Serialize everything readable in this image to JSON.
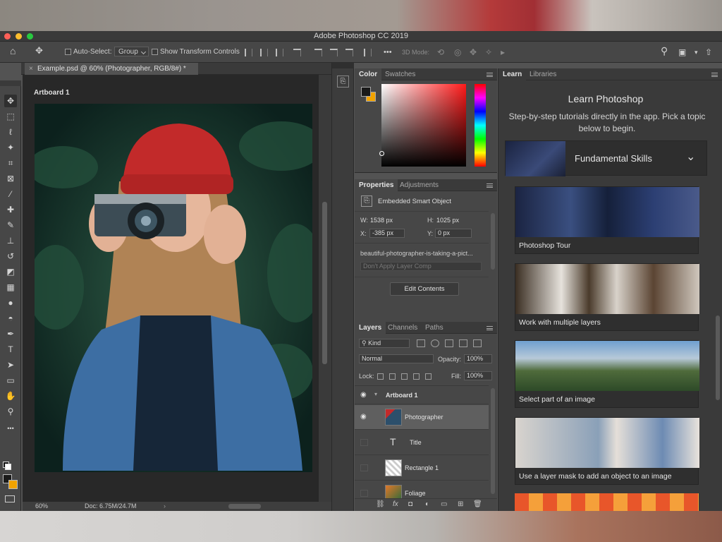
{
  "window": {
    "title": "Adobe Photoshop CC 2019"
  },
  "options_bar": {
    "auto_select_label": "Auto-Select:",
    "auto_select_value": "Group",
    "show_transform_label": "Show Transform Controls",
    "mode_3d_label": "3D Mode:",
    "more_label": "•••"
  },
  "tools": [
    {
      "name": "move-tool",
      "glyph": "✥"
    },
    {
      "name": "marquee-tool",
      "glyph": "⬚"
    },
    {
      "name": "lasso-tool",
      "glyph": "ℓ"
    },
    {
      "name": "magic-wand-tool",
      "glyph": "✦"
    },
    {
      "name": "crop-tool",
      "glyph": "⌗"
    },
    {
      "name": "frame-tool",
      "glyph": "⊠"
    },
    {
      "name": "eyedropper-tool",
      "glyph": "⁄"
    },
    {
      "name": "healing-brush-tool",
      "glyph": "✚"
    },
    {
      "name": "brush-tool",
      "glyph": "✎"
    },
    {
      "name": "clone-stamp-tool",
      "glyph": "⊥"
    },
    {
      "name": "history-brush-tool",
      "glyph": "↺"
    },
    {
      "name": "eraser-tool",
      "glyph": "◩"
    },
    {
      "name": "gradient-tool",
      "glyph": "▦"
    },
    {
      "name": "blur-tool",
      "glyph": "●"
    },
    {
      "name": "dodge-tool",
      "glyph": "◓"
    },
    {
      "name": "pen-tool",
      "glyph": "✒"
    },
    {
      "name": "type-tool",
      "glyph": "T"
    },
    {
      "name": "path-selection-tool",
      "glyph": "➤"
    },
    {
      "name": "rectangle-tool",
      "glyph": "▭"
    },
    {
      "name": "hand-tool",
      "glyph": "✋"
    },
    {
      "name": "zoom-tool",
      "glyph": "⚲"
    },
    {
      "name": "more-tools",
      "glyph": "•••"
    }
  ],
  "document": {
    "tab_title": "Example.psd @ 60% (Photographer, RGB/8#) *",
    "artboard_label": "Artboard 1",
    "zoom": "60%",
    "doc_size": "Doc: 6.75M/24.7M"
  },
  "color_panel": {
    "tabs": [
      "Color",
      "Swatches"
    ],
    "fg_color": "#1a1a1a",
    "bg_color": "#f2a300"
  },
  "properties": {
    "tabs": [
      "Properties",
      "Adjustments"
    ],
    "kind": "Embedded Smart Object",
    "w_label": "W:",
    "w": "1538 px",
    "h_label": "H:",
    "h": "1025 px",
    "x_label": "X:",
    "x": "-385 px",
    "y_label": "Y:",
    "y": "0 px",
    "filename": "beautiful-photographer-is-taking-a-pict...",
    "layer_comp": "Don't Apply Layer Comp",
    "edit_button": "Edit Contents"
  },
  "layers": {
    "tabs": [
      "Layers",
      "Channels",
      "Paths"
    ],
    "filter_kind": "Kind",
    "blend_mode": "Normal",
    "opacity_label": "Opacity:",
    "opacity": "100%",
    "lock_label": "Lock:",
    "fill_label": "Fill:",
    "fill": "100%",
    "items": [
      {
        "name": "Artboard 1",
        "visible": true,
        "selected": false
      },
      {
        "name": "Photographer",
        "visible": true,
        "selected": true
      },
      {
        "name": "Title",
        "visible": false,
        "selected": false
      },
      {
        "name": "Rectangle 1",
        "visible": false,
        "selected": false
      },
      {
        "name": "Foliage",
        "visible": false,
        "selected": false
      }
    ]
  },
  "learn": {
    "tabs": [
      "Learn",
      "Libraries"
    ],
    "heading": "Learn Photoshop",
    "intro": "Step-by-step tutorials directly in the app. Pick a topic below to begin.",
    "section": "Fundamental Skills",
    "cards": [
      "Photoshop Tour",
      "Work with multiple layers",
      "Select part of an image",
      "Use a layer mask to add an object to an image"
    ]
  }
}
